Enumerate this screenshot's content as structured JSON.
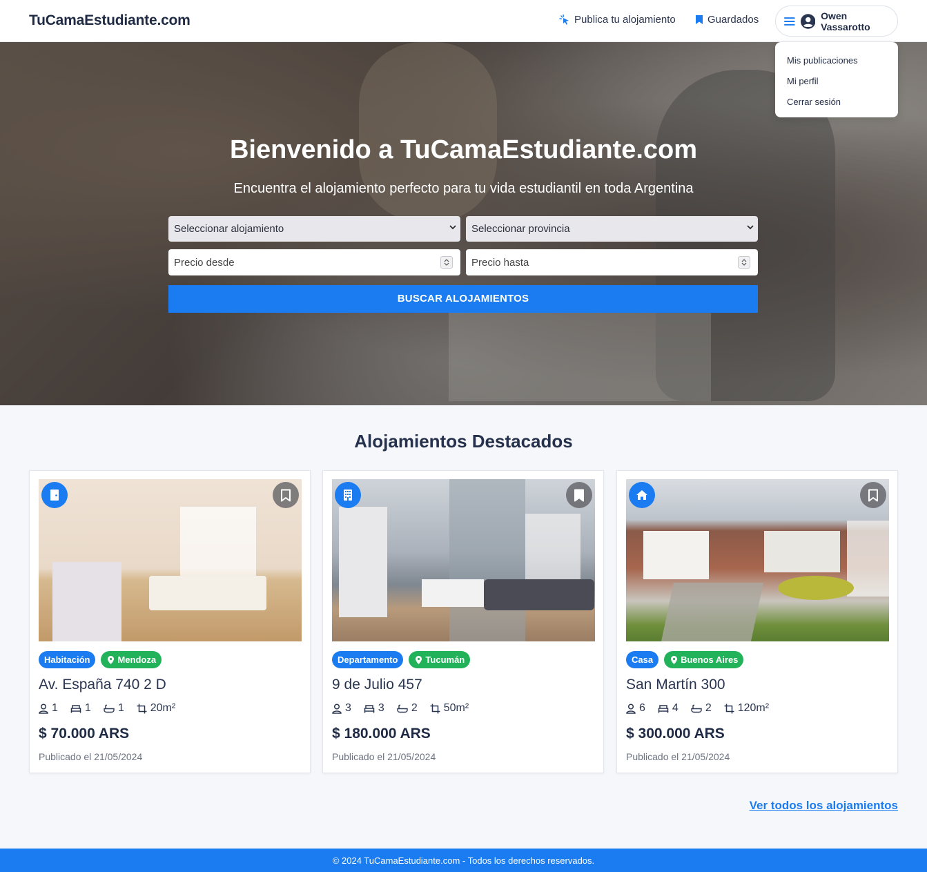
{
  "header": {
    "brand": "TuCamaEstudiante.com",
    "publish_label": "Publica tu alojamiento",
    "saved_label": "Guardados",
    "user_name": "Owen Vassarotto"
  },
  "user_menu": {
    "items": [
      "Mis publicaciones",
      "Mi perfil",
      "Cerrar sesión"
    ]
  },
  "hero": {
    "title": "Bienvenido a TuCamaEstudiante.com",
    "subtitle": "Encuentra el alojamiento perfecto para tu vida estudiantil en toda Argentina",
    "accommodation_select": "Seleccionar alojamiento",
    "province_select": "Seleccionar provincia",
    "price_from_placeholder": "Precio desde",
    "price_to_placeholder": "Precio hasta",
    "search_button": "BUSCAR ALOJAMIENTOS"
  },
  "featured": {
    "title": "Alojamientos Destacados",
    "listings": [
      {
        "type": "Habitación",
        "type_icon": "door-icon",
        "location": "Mendoza",
        "address": "Av. España 740 2 D",
        "people": "1",
        "beds": "1",
        "baths": "1",
        "area": "20m²",
        "price": "$ 70.000 ARS",
        "published": "Publicado el 21/05/2024"
      },
      {
        "type": "Departamento",
        "type_icon": "building-icon",
        "location": "Tucumán",
        "address": "9 de Julio 457",
        "people": "3",
        "beds": "3",
        "baths": "2",
        "area": "50m²",
        "price": "$ 180.000 ARS",
        "published": "Publicado el 21/05/2024"
      },
      {
        "type": "Casa",
        "type_icon": "house-icon",
        "location": "Buenos Aires",
        "address": "San Martín 300",
        "people": "6",
        "beds": "4",
        "baths": "2",
        "area": "120m²",
        "price": "$ 300.000 ARS",
        "published": "Publicado el 21/05/2024"
      }
    ],
    "see_all": "Ver todos los alojamientos"
  },
  "footer": {
    "text": "© 2024 TuCamaEstudiante.com - Todos los derechos reservados."
  },
  "colors": {
    "primary": "#1a7cf0",
    "location_badge": "#22b35a",
    "text_dark": "#1f2a44"
  }
}
